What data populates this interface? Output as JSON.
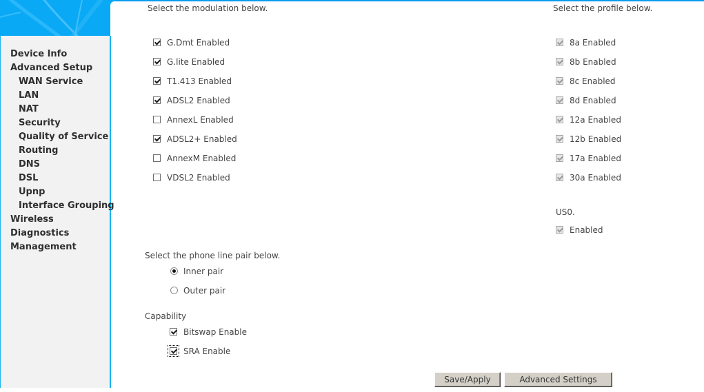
{
  "sidebar": {
    "items": [
      {
        "label": "Device Info",
        "level": 0
      },
      {
        "label": "Advanced Setup",
        "level": 0
      },
      {
        "label": "WAN Service",
        "level": 1
      },
      {
        "label": "LAN",
        "level": 1
      },
      {
        "label": "NAT",
        "level": 1
      },
      {
        "label": "Security",
        "level": 1
      },
      {
        "label": "Quality of Service",
        "level": 1
      },
      {
        "label": "Routing",
        "level": 1
      },
      {
        "label": "DNS",
        "level": 1
      },
      {
        "label": "DSL",
        "level": 1
      },
      {
        "label": "Upnp",
        "level": 1
      },
      {
        "label": "Interface Grouping",
        "level": 1
      },
      {
        "label": "Wireless",
        "level": 0
      },
      {
        "label": "Diagnostics",
        "level": 0
      },
      {
        "label": "Management",
        "level": 0
      }
    ]
  },
  "modulation": {
    "heading": "Select the modulation below.",
    "options": [
      {
        "label": "G.Dmt Enabled",
        "checked": true
      },
      {
        "label": "G.lite Enabled",
        "checked": true
      },
      {
        "label": "T1.413 Enabled",
        "checked": true
      },
      {
        "label": "ADSL2 Enabled",
        "checked": true
      },
      {
        "label": "AnnexL Enabled",
        "checked": false
      },
      {
        "label": "ADSL2+ Enabled",
        "checked": true
      },
      {
        "label": "AnnexM Enabled",
        "checked": false
      },
      {
        "label": "VDSL2 Enabled",
        "checked": false
      }
    ]
  },
  "profile": {
    "heading": "Select the profile below.",
    "options": [
      {
        "label": "8a Enabled",
        "checked": true,
        "disabled": true
      },
      {
        "label": "8b Enabled",
        "checked": true,
        "disabled": true
      },
      {
        "label": "8c Enabled",
        "checked": true,
        "disabled": true
      },
      {
        "label": "8d Enabled",
        "checked": true,
        "disabled": true
      },
      {
        "label": "12a Enabled",
        "checked": true,
        "disabled": true
      },
      {
        "label": "12b Enabled",
        "checked": true,
        "disabled": true
      },
      {
        "label": "17a Enabled",
        "checked": true,
        "disabled": true
      },
      {
        "label": "30a Enabled",
        "checked": true,
        "disabled": true
      }
    ],
    "us0_heading": "US0.",
    "us0_option": {
      "label": "Enabled",
      "checked": true,
      "disabled": true
    }
  },
  "phone_line": {
    "heading": "Select the phone line pair below.",
    "options": [
      {
        "label": "Inner pair",
        "selected": true
      },
      {
        "label": "Outer pair",
        "selected": false
      }
    ]
  },
  "capability": {
    "heading": "Capability",
    "options": [
      {
        "label": "Bitswap Enable",
        "checked": true
      },
      {
        "label": "SRA Enable",
        "checked": true,
        "focused": true
      }
    ]
  },
  "buttons": {
    "save_apply": "Save/Apply",
    "advanced_settings": "Advanced Settings"
  },
  "colors": {
    "brand_blue": "#0aa9f5",
    "sidebar_bg": "#f2f2f2",
    "button_face": "#d4d0c8"
  }
}
